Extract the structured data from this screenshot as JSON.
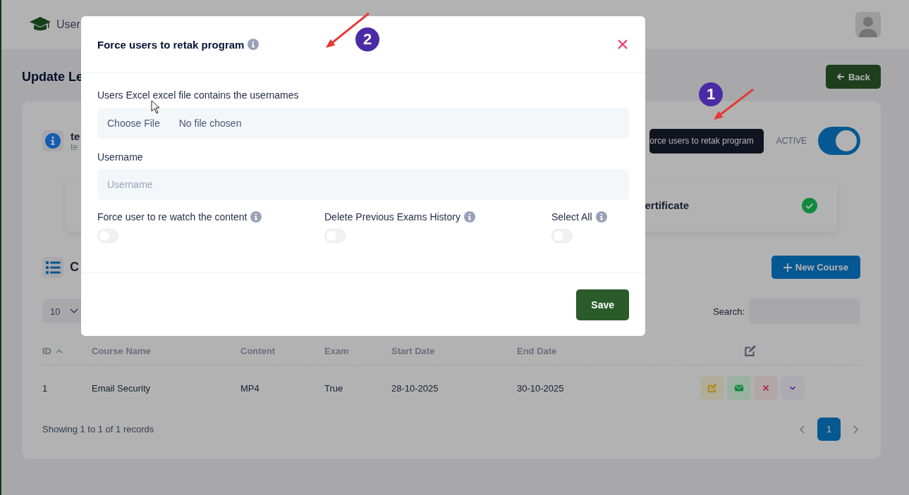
{
  "header": {
    "brand": "User"
  },
  "page": {
    "title": "Update Le",
    "back_button": "Back"
  },
  "program_card": {
    "name": "te",
    "subtitle": "te",
    "retake_button": "orce users to retak program",
    "status_label": "ACTIVE",
    "active": true,
    "certificate": {
      "label": "ertificate",
      "done": true
    }
  },
  "courses": {
    "title": "C",
    "new_button": "New Course",
    "page_size": "10",
    "search_label": "Search:",
    "columns": [
      {
        "label": "ID",
        "sorted": true
      },
      {
        "label": "Course Name",
        "sorted": false
      },
      {
        "label": "Content",
        "sorted": false
      },
      {
        "label": "Exam",
        "sorted": false
      },
      {
        "label": "Start Date",
        "sorted": false
      },
      {
        "label": "End Date",
        "sorted": false
      }
    ],
    "rows": [
      {
        "cells": [
          "1",
          "Email Security",
          "MP4",
          "True",
          "28-10-2025",
          "30-10-2025"
        ]
      }
    ],
    "info": "Showing 1 to 1 of 1 records",
    "pages": [
      {
        "label": "1",
        "selected": true
      }
    ]
  },
  "modal": {
    "title": "Force users to retak program",
    "file_label": "Users Excel excel file contains the usernames",
    "file_button": "Choose File",
    "file_status": "No file chosen",
    "username_label": "Username",
    "username_placeholder": "Username",
    "options": [
      {
        "label": "Force user to re watch the content",
        "on": false
      },
      {
        "label": "Delete Previous Exams History",
        "on": false
      },
      {
        "label": "Select All",
        "on": false
      }
    ],
    "save_button": "Save"
  },
  "annotations": [
    {
      "label": "1"
    },
    {
      "label": "2"
    }
  ]
}
